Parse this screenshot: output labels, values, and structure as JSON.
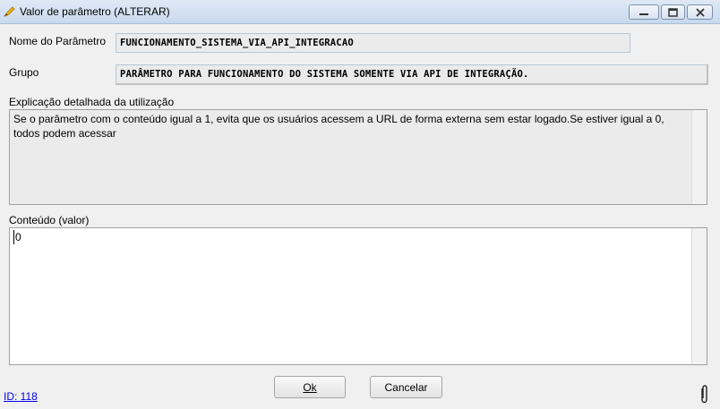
{
  "window": {
    "title": "Valor de parâmetro (ALTERAR)",
    "icon": "edit-pencil-icon",
    "controls": [
      "minimize-icon",
      "maximize-icon",
      "close-icon"
    ]
  },
  "form": {
    "nome_label": "Nome do Parâmetro",
    "nome_value": "FUNCIONAMENTO_SISTEMA_VIA_API_INTEGRACAO",
    "grupo_label": "Grupo",
    "grupo_value": "PARÂMETRO PARA FUNCIONAMENTO DO SISTEMA SOMENTE VIA API DE INTEGRAÇÃO.",
    "explicacao_label": "Explicação detalhada da utilização",
    "explicacao_text": "Se o parâmetro com o conteúdo igual a 1, evita que os usuários acessem a URL de forma externa sem estar logado.Se estiver igual a 0, todos podem acessar",
    "conteudo_label": "Conteúdo (valor)",
    "conteudo_value": "0"
  },
  "buttons": {
    "ok": "Ok",
    "cancel": "Cancelar"
  },
  "footer": {
    "id_link": "ID: 118",
    "attachment_icon": "paperclip-icon"
  },
  "colors": {
    "titlebar": "#c9d9ee",
    "field_bg": "#ebebeb",
    "link": "#0000ee"
  }
}
